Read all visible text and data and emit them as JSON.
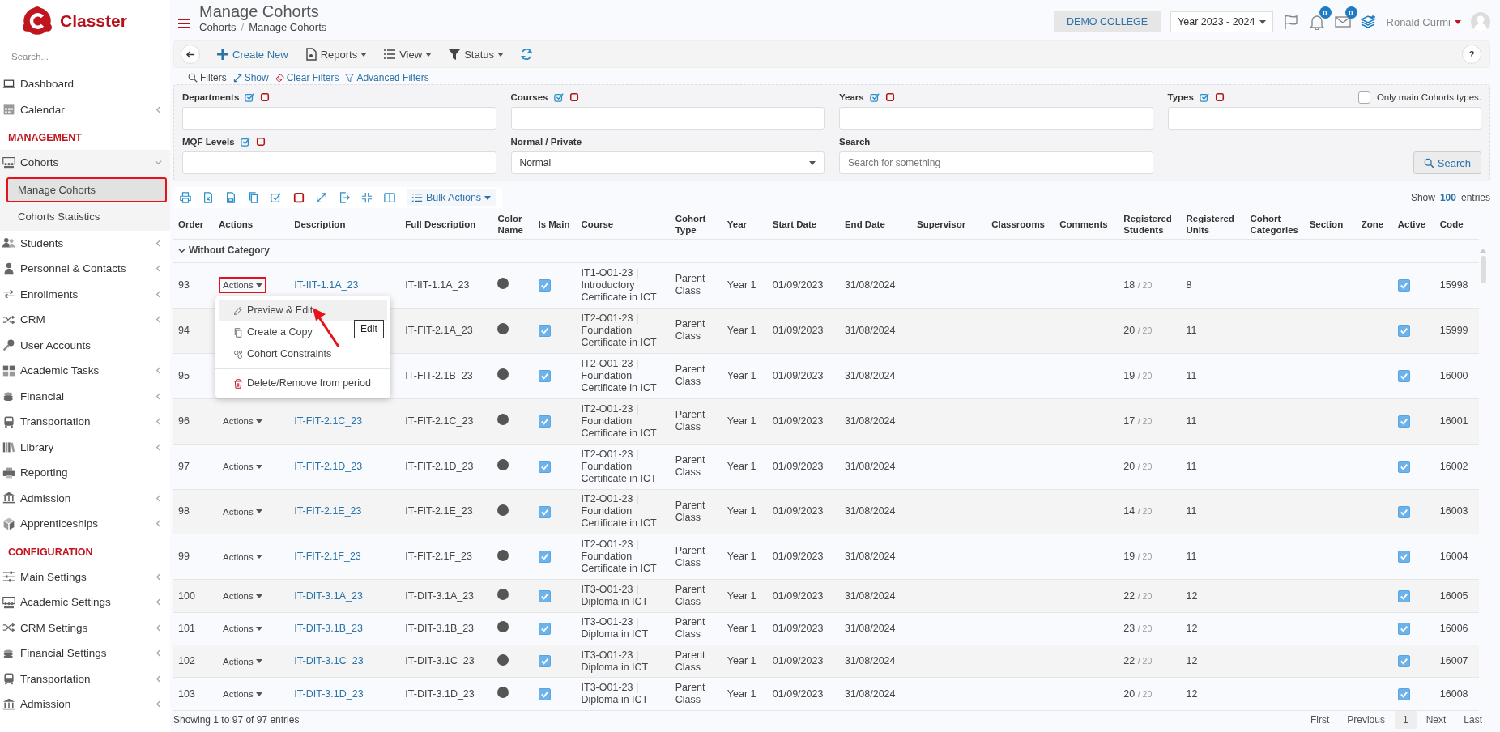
{
  "brand": {
    "name": "Classter"
  },
  "sidebar": {
    "search_placeholder": "Search...",
    "sections": [
      {
        "items": [
          {
            "label": "Dashboard",
            "has_submenu": false
          },
          {
            "label": "Calendar",
            "has_submenu": true,
            "expanded": false
          }
        ]
      },
      {
        "title": "MANAGEMENT",
        "items": [
          {
            "label": "Cohorts",
            "has_submenu": true,
            "expanded": true,
            "children": [
              {
                "label": "Manage Cohorts",
                "selected": true,
                "highlighted": true
              },
              {
                "label": "Cohorts Statistics",
                "selected": false,
                "highlighted": false
              }
            ]
          },
          {
            "label": "Students",
            "has_submenu": true,
            "expanded": false
          },
          {
            "label": "Personnel & Contacts",
            "has_submenu": true,
            "expanded": false
          },
          {
            "label": "Enrollments",
            "has_submenu": true,
            "expanded": false
          },
          {
            "label": "CRM",
            "has_submenu": true,
            "expanded": false
          },
          {
            "label": "User Accounts",
            "has_submenu": false
          },
          {
            "label": "Academic Tasks",
            "has_submenu": true,
            "expanded": false
          },
          {
            "label": "Financial",
            "has_submenu": true,
            "expanded": false
          },
          {
            "label": "Transportation",
            "has_submenu": true,
            "expanded": false
          },
          {
            "label": "Library",
            "has_submenu": true,
            "expanded": false
          },
          {
            "label": "Reporting",
            "has_submenu": false
          },
          {
            "label": "Admission",
            "has_submenu": true,
            "expanded": false
          },
          {
            "label": "Apprenticeships",
            "has_submenu": true,
            "expanded": false
          }
        ]
      },
      {
        "title": "CONFIGURATION",
        "items": [
          {
            "label": "Main Settings",
            "has_submenu": true,
            "expanded": false
          },
          {
            "label": "Academic Settings",
            "has_submenu": true,
            "expanded": false
          },
          {
            "label": "CRM Settings",
            "has_submenu": true,
            "expanded": false
          },
          {
            "label": "Financial Settings",
            "has_submenu": true,
            "expanded": false
          },
          {
            "label": "Transportation",
            "has_submenu": true,
            "expanded": false
          },
          {
            "label": "Admission",
            "has_submenu": true,
            "expanded": false
          }
        ]
      }
    ]
  },
  "header": {
    "title": "Manage Cohorts",
    "breadcrumb": {
      "items": [
        "Cohorts",
        "Manage Cohorts"
      ],
      "separator": "/"
    },
    "institution": "DEMO COLLEGE",
    "year": "Year 2023 - 2024",
    "notifications": "0",
    "messages": "0",
    "user": "Ronald Curmi"
  },
  "toolbar": {
    "buttons": [
      {
        "label": "Create New",
        "kind": "create"
      },
      {
        "label": "Reports",
        "kind": "menu"
      },
      {
        "label": "View",
        "kind": "menu"
      },
      {
        "label": "Status",
        "kind": "menu"
      }
    ],
    "help": "?"
  },
  "filters": {
    "title": "Filters",
    "links": [
      "Show",
      "Clear Filters",
      "Advanced Filters"
    ],
    "fields": [
      {
        "label": "Departments",
        "kind": "multi"
      },
      {
        "label": "Courses",
        "kind": "multi"
      },
      {
        "label": "Years",
        "kind": "multi"
      },
      {
        "label": "Types",
        "kind": "multi",
        "option": {
          "label": "Only main Cohorts types.",
          "checked": false
        }
      },
      {
        "label": "MQF Levels",
        "kind": "multi"
      },
      {
        "label": "Normal / Private",
        "kind": "select",
        "value": "Normal"
      },
      {
        "label": "Search",
        "kind": "text",
        "placeholder": "Search for something"
      }
    ],
    "search_button": "Search"
  },
  "table_toolbar": {
    "bulk_actions": "Bulk Actions",
    "show": "Show",
    "page_size": "100",
    "entries": "entries"
  },
  "table": {
    "columns": [
      "Order",
      "Actions",
      "Description",
      "Full Description",
      "Color Name",
      "Is Main",
      "Course",
      "Cohort Type",
      "Year",
      "Start Date",
      "End Date",
      "Supervisor",
      "Classrooms",
      "Comments",
      "Registered Students",
      "Registered Units",
      "Cohort Categories",
      "Section",
      "Zone",
      "Active",
      "Code"
    ],
    "group": {
      "label": "Without Category",
      "expanded": true
    },
    "rows": [
      {
        "order": "93",
        "actions": {
          "label": "Actions",
          "highlighted": true
        },
        "description": "IT-IIT-1.1A_23",
        "full_description": "IT-IIT-1.1A_23",
        "color": "#555555",
        "is_main": true,
        "course": "IT1-O01-23 | Introductory Certificate in ICT",
        "cohort_type": "Parent Class",
        "year": "Year 1",
        "start_date": "01/09/2023",
        "end_date": "31/08/2024",
        "registered_students": "18",
        "capacity": "/ 20",
        "registered_units": "8",
        "active": true,
        "code": "15998"
      },
      {
        "order": "94",
        "full_description": "IT-FIT-2.1A_23",
        "color": "#555555",
        "is_main": true,
        "course": "IT2-O01-23 | Foundation Certificate in ICT",
        "cohort_type": "Parent Class",
        "year": "Year 1",
        "start_date": "01/09/2023",
        "end_date": "31/08/2024",
        "registered_students": "20",
        "capacity": "/ 20",
        "registered_units": "11",
        "active": true,
        "code": "15999"
      },
      {
        "order": "95",
        "full_description": "IT-FIT-2.1B_23",
        "color": "#555555",
        "is_main": true,
        "course": "IT2-O01-23 | Foundation Certificate in ICT",
        "cohort_type": "Parent Class",
        "year": "Year 1",
        "start_date": "01/09/2023",
        "end_date": "31/08/2024",
        "registered_students": "19",
        "capacity": "/ 20",
        "registered_units": "11",
        "active": true,
        "code": "16000"
      },
      {
        "order": "96",
        "actions": {
          "label": "Actions",
          "highlighted": false
        },
        "description": "IT-FIT-2.1C_23",
        "full_description": "IT-FIT-2.1C_23",
        "color": "#555555",
        "is_main": true,
        "course": "IT2-O01-23 | Foundation Certificate in ICT",
        "cohort_type": "Parent Class",
        "year": "Year 1",
        "start_date": "01/09/2023",
        "end_date": "31/08/2024",
        "registered_students": "17",
        "capacity": "/ 20",
        "registered_units": "11",
        "active": true,
        "code": "16001"
      },
      {
        "order": "97",
        "actions": {
          "label": "Actions",
          "highlighted": false
        },
        "description": "IT-FIT-2.1D_23",
        "full_description": "IT-FIT-2.1D_23",
        "color": "#555555",
        "is_main": true,
        "course": "IT2-O01-23 | Foundation Certificate in ICT",
        "cohort_type": "Parent Class",
        "year": "Year 1",
        "start_date": "01/09/2023",
        "end_date": "31/08/2024",
        "registered_students": "20",
        "capacity": "/ 20",
        "registered_units": "11",
        "active": true,
        "code": "16002"
      },
      {
        "order": "98",
        "actions": {
          "label": "Actions",
          "highlighted": false
        },
        "description": "IT-FIT-2.1E_23",
        "full_description": "IT-FIT-2.1E_23",
        "color": "#555555",
        "is_main": true,
        "course": "IT2-O01-23 | Foundation Certificate in ICT",
        "cohort_type": "Parent Class",
        "year": "Year 1",
        "start_date": "01/09/2023",
        "end_date": "31/08/2024",
        "registered_students": "14",
        "capacity": "/ 20",
        "registered_units": "11",
        "active": true,
        "code": "16003"
      },
      {
        "order": "99",
        "actions": {
          "label": "Actions",
          "highlighted": false
        },
        "description": "IT-FIT-2.1F_23",
        "full_description": "IT-FIT-2.1F_23",
        "color": "#555555",
        "is_main": true,
        "course": "IT2-O01-23 | Foundation Certificate in ICT",
        "cohort_type": "Parent Class",
        "year": "Year 1",
        "start_date": "01/09/2023",
        "end_date": "31/08/2024",
        "registered_students": "19",
        "capacity": "/ 20",
        "registered_units": "11",
        "active": true,
        "code": "16004"
      },
      {
        "order": "100",
        "actions": {
          "label": "Actions",
          "highlighted": false
        },
        "description": "IT-DIT-3.1A_23",
        "full_description": "IT-DIT-3.1A_23",
        "color": "#555555",
        "is_main": true,
        "course": "IT3-O01-23 | Diploma in ICT",
        "cohort_type": "Parent Class",
        "year": "Year 1",
        "start_date": "01/09/2023",
        "end_date": "31/08/2024",
        "registered_students": "22",
        "capacity": "/ 20",
        "registered_units": "12",
        "active": true,
        "code": "16005"
      },
      {
        "order": "101",
        "actions": {
          "label": "Actions",
          "highlighted": false
        },
        "description": "IT-DIT-3.1B_23",
        "full_description": "IT-DIT-3.1B_23",
        "color": "#555555",
        "is_main": true,
        "course": "IT3-O01-23 | Diploma in ICT",
        "cohort_type": "Parent Class",
        "year": "Year 1",
        "start_date": "01/09/2023",
        "end_date": "31/08/2024",
        "registered_students": "23",
        "capacity": "/ 20",
        "registered_units": "12",
        "active": true,
        "code": "16006"
      },
      {
        "order": "102",
        "actions": {
          "label": "Actions",
          "highlighted": false
        },
        "description": "IT-DIT-3.1C_23",
        "full_description": "IT-DIT-3.1C_23",
        "color": "#555555",
        "is_main": true,
        "course": "IT3-O01-23 | Diploma in ICT",
        "cohort_type": "Parent Class",
        "year": "Year 1",
        "start_date": "01/09/2023",
        "end_date": "31/08/2024",
        "registered_students": "22",
        "capacity": "/ 20",
        "registered_units": "12",
        "active": true,
        "code": "16007"
      },
      {
        "order": "103",
        "actions": {
          "label": "Actions",
          "highlighted": false
        },
        "description": "IT-DIT-3.1D_23",
        "full_description": "IT-DIT-3.1D_23",
        "color": "#555555",
        "is_main": true,
        "course": "IT3-O01-23 | Diploma in ICT",
        "cohort_type": "Parent Class",
        "year": "Year 1",
        "start_date": "01/09/2023",
        "end_date": "31/08/2024",
        "registered_students": "20",
        "capacity": "/ 20",
        "registered_units": "12",
        "active": true,
        "code": "16008"
      }
    ]
  },
  "actions_menu": {
    "items": [
      {
        "label": "Preview & Edit",
        "kind": "edit",
        "selected": true
      },
      {
        "label": "Create a Copy",
        "kind": "copy",
        "selected": false
      },
      {
        "label": "Cohort Constraints",
        "kind": "constraints",
        "selected": false
      },
      {
        "label": "Delete/Remove from period",
        "kind": "delete",
        "selected": false
      }
    ],
    "tooltip": "Edit"
  },
  "footer": {
    "summary": "Showing 1 to 97 of 97 entries",
    "pages": [
      {
        "label": "First",
        "selected": false
      },
      {
        "label": "Previous",
        "selected": false
      },
      {
        "label": "1",
        "selected": true
      },
      {
        "label": "Next",
        "selected": false
      },
      {
        "label": "Last",
        "selected": false
      }
    ]
  }
}
